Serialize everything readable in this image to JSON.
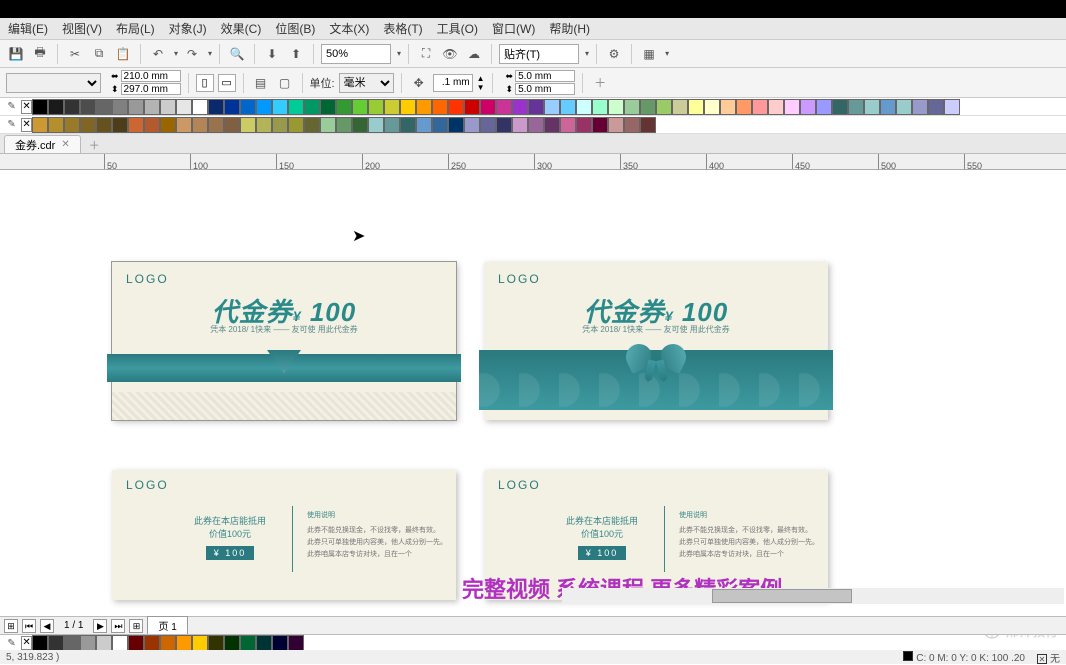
{
  "menubar": [
    "编辑(E)",
    "视图(V)",
    "布局(L)",
    "对象(J)",
    "效果(C)",
    "位图(B)",
    "文本(X)",
    "表格(T)",
    "工具(O)",
    "窗口(W)",
    "帮助(H)"
  ],
  "toolbar1": {
    "zoom": "50%",
    "snap_label": "贴齐(T)"
  },
  "toolbar2": {
    "page_w": "210.0 mm",
    "page_h": "297.0 mm",
    "unit_label": "单位:",
    "unit_value": "毫米",
    "nudge": ".1 mm",
    "dup_x": "5.0 mm",
    "dup_y": "5.0 mm"
  },
  "doc_tab": {
    "name": "金券.cdr"
  },
  "ruler_ticks": [
    50,
    100,
    150,
    200,
    250,
    300,
    350,
    400,
    450,
    500,
    550
  ],
  "cards": {
    "logo": "LOGO",
    "headline_a": "代金券",
    "amount": "100",
    "yen": "¥",
    "sub": "凭本 2018/ 1快来 ——  友可使 用此代金券",
    "back_title": "此券在本店能抵用",
    "back_value": "价值100元",
    "stamp": "¥ 100",
    "usage_title": "使用说明",
    "usage_line1": "此券不能兑换现金，不设找零，最终有效。",
    "usage_line2": "此券只可单独使用内容美，他人成分别一先。",
    "usage_line3": "此券咱属本店专访对块，且在一个"
  },
  "overlay": "完整视频  系统课程  更多精彩案例",
  "watermark": "邢帅教育",
  "page_nav": {
    "counter": "1 / 1",
    "page_tab": "页 1"
  },
  "status": {
    "coords": "5, 319.823 )",
    "fill_label": "C: 0 M: 0 Y: 0 K: 100  .20",
    "none_label": "无"
  },
  "palette_top_gray": [
    "#000000",
    "#1a1a1a",
    "#333333",
    "#4d4d4d",
    "#666666",
    "#808080",
    "#999999",
    "#b3b3b3",
    "#cccccc",
    "#e6e6e6",
    "#ffffff"
  ],
  "palette_top_colors": [
    "#0a2a6c",
    "#003399",
    "#0066cc",
    "#0099ff",
    "#33ccff",
    "#00cc99",
    "#009966",
    "#006633",
    "#339933",
    "#66cc33",
    "#99cc33",
    "#cccc33",
    "#ffcc00",
    "#ff9900",
    "#ff6600",
    "#ff3300",
    "#cc0000",
    "#cc0066",
    "#cc3399",
    "#9933cc",
    "#663399",
    "#99ccff",
    "#66ccff",
    "#ccffff",
    "#99ffcc",
    "#ccffcc",
    "#99cc99",
    "#669966",
    "#99cc66",
    "#cccc99",
    "#ffff99",
    "#ffffcc",
    "#ffcc99",
    "#ff9966",
    "#ff9999",
    "#ffcccc",
    "#ffccff",
    "#cc99ff",
    "#9999ff",
    "#336666",
    "#669999",
    "#99cccc",
    "#6699cc",
    "#99cccc",
    "#9999cc",
    "#666699",
    "#ccccff"
  ],
  "palette_row2": [
    "#cc9933",
    "#b38f2e",
    "#997a29",
    "#806624",
    "#66521f",
    "#4d3d19",
    "#cc6633",
    "#b35a2e",
    "#996600",
    "#cc9966",
    "#b38659",
    "#99734d",
    "#806040",
    "#cccc66",
    "#b3b359",
    "#99994d",
    "#999933",
    "#666633",
    "#99cc99",
    "#669966",
    "#336633",
    "#99cccc",
    "#669999",
    "#336666",
    "#6699cc",
    "#336699",
    "#003366",
    "#9999cc",
    "#666699",
    "#333366",
    "#cc99cc",
    "#996699",
    "#663366",
    "#cc6699",
    "#993366",
    "#660033",
    "#cc9999",
    "#996666",
    "#663333"
  ],
  "palette_bottom": [
    "#000000",
    "#333333",
    "#666666",
    "#999999",
    "#cccccc",
    "#ffffff",
    "#660000",
    "#993300",
    "#cc6600",
    "#ff9900",
    "#ffcc00",
    "#333300",
    "#003300",
    "#006633",
    "#003333",
    "#000033",
    "#330033"
  ]
}
